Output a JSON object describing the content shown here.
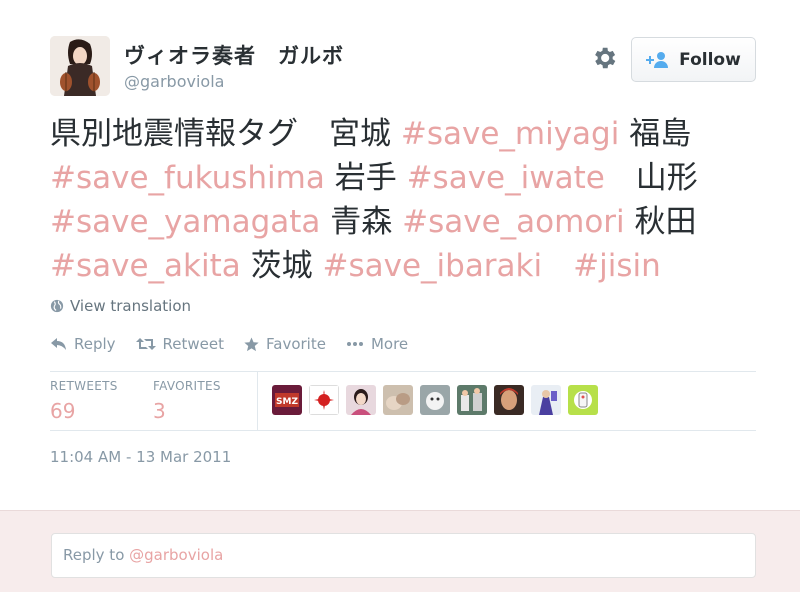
{
  "author": {
    "display_name": "ヴィオラ奏者　ガルボ",
    "handle": "@garboviola",
    "avatar_icon": "viola-player-avatar"
  },
  "header": {
    "settings_icon": "gear-icon",
    "follow_label": "Follow"
  },
  "tweet": {
    "lines": [
      [
        {
          "t": "県別地震情報タグ　宮城 "
        },
        {
          "t": "#save_miyagi",
          "h": true
        },
        {
          "t": " 福島"
        }
      ],
      [
        {
          "t": "#save_fukushima",
          "h": true
        },
        {
          "t": " 岩手 "
        },
        {
          "t": "#save_iwate",
          "h": true
        },
        {
          "t": "　山形"
        }
      ],
      [
        {
          "t": "#save_yamagata",
          "h": true
        },
        {
          "t": " 青森 "
        },
        {
          "t": "#save_aomori",
          "h": true
        },
        {
          "t": " 秋田"
        }
      ],
      [
        {
          "t": "#save_akita",
          "h": true
        },
        {
          "t": " 茨城 "
        },
        {
          "t": "#save_ibaraki",
          "h": true
        },
        {
          "t": "　"
        },
        {
          "t": "#jisin",
          "h": true
        }
      ]
    ],
    "translate_label": "View translation",
    "actions": {
      "reply": "Reply",
      "retweet": "Retweet",
      "favorite": "Favorite",
      "more": "More"
    },
    "stats": {
      "retweets_label": "RETWEETS",
      "retweets_count": "69",
      "favorites_label": "FAVORITES",
      "favorites_count": "3"
    },
    "retweeter_avatars": [
      "SMZ",
      "",
      "",
      "",
      "",
      "",
      "",
      "",
      ""
    ],
    "timestamp": "11:04 AM - 13 Mar 2011"
  },
  "reply": {
    "prefix": "Reply to ",
    "handle": "@garboviola"
  },
  "colors": {
    "hashtag": "#e8a4a4",
    "text": "#292f33",
    "muted": "#8899a6",
    "reply_bg": "#f7ecec"
  }
}
